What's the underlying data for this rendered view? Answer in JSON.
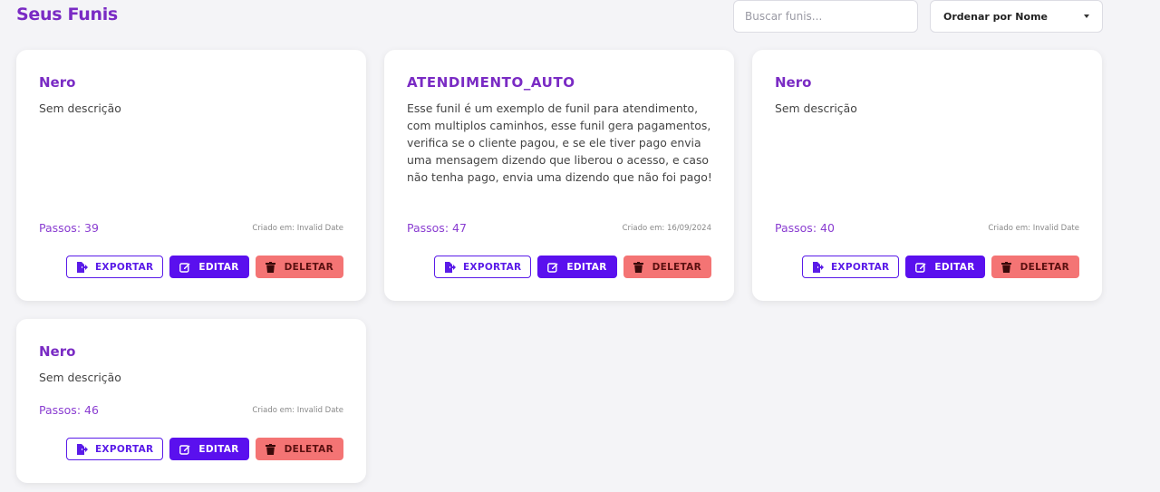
{
  "header": {
    "title": "Seus Funis",
    "search_placeholder": "Buscar funis...",
    "sort_label": "Ordenar por Nome"
  },
  "buttons": {
    "export": "EXPORTAR",
    "edit": "EDITAR",
    "delete": "DELETAR"
  },
  "colors": {
    "accent": "#7a2bc4",
    "primary": "#5a10ee",
    "danger": "#f47474"
  },
  "funnels": [
    {
      "name": "Nero",
      "description": "Sem descrição",
      "steps": "Passos: 39",
      "created": "Criado em: Invalid Date"
    },
    {
      "name": "ATENDIMENTO_AUTO",
      "description": "Esse funil é um exemplo de funil para atendimento, com multiplos caminhos, esse funil gera pagamentos, verifica se o cliente pagou, e se ele tiver pago envia uma mensagem dizendo que liberou o acesso, e caso não tenha pago, envia uma dizendo que não foi pago!",
      "steps": "Passos: 47",
      "created": "Criado em: 16/09/2024"
    },
    {
      "name": "Nero",
      "description": "Sem descrição",
      "steps": "Passos: 40",
      "created": "Criado em: Invalid Date"
    },
    {
      "name": "Nero",
      "description": "Sem descrição",
      "steps": "Passos: 46",
      "created": "Criado em: Invalid Date"
    }
  ]
}
